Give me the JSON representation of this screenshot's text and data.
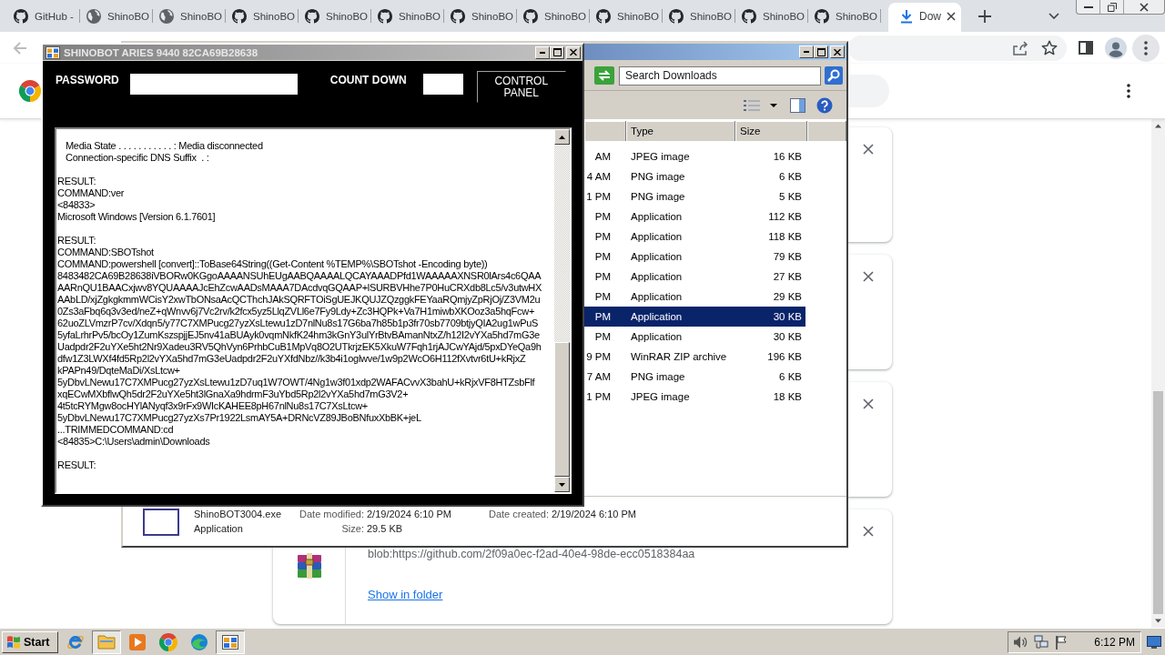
{
  "browser": {
    "tabs": [
      {
        "title": "GitHub -",
        "kind": "github",
        "selected": false
      },
      {
        "title": "ShinoBO",
        "kind": "globe",
        "selected": false
      },
      {
        "title": "ShinoBO",
        "kind": "globe",
        "selected": false
      },
      {
        "title": "ShinoBO",
        "kind": "github",
        "selected": false
      },
      {
        "title": "ShinoBO",
        "kind": "github",
        "selected": false
      },
      {
        "title": "ShinoBO",
        "kind": "github",
        "selected": false
      },
      {
        "title": "ShinoBO",
        "kind": "github",
        "selected": false
      },
      {
        "title": "ShinoBO",
        "kind": "github",
        "selected": false
      },
      {
        "title": "ShinoBO",
        "kind": "github",
        "selected": false
      },
      {
        "title": "ShinoBO",
        "kind": "github",
        "selected": false
      },
      {
        "title": "ShinoBO",
        "kind": "github",
        "selected": false
      },
      {
        "title": "ShinoBO",
        "kind": "github",
        "selected": false
      },
      {
        "title": "Dow",
        "kind": "download",
        "selected": true
      }
    ]
  },
  "shinobot": {
    "title": "SHINOBOT ARIES 9440 82CA69B28638",
    "password_label": "PASSWORD",
    "countdown_label": "COUNT DOWN",
    "control_button": "CONTROL PANEL",
    "output": [
      {
        "indent": true,
        "lines": [
          "Media State . . . . . . . . . . . : Media disconnected",
          "Connection-specific DNS Suffix  . :"
        ]
      },
      {
        "indent": false,
        "lines": [
          "RESULT:",
          "COMMAND:ver",
          "<84833>",
          "Microsoft Windows [Version 6.1.7601]"
        ]
      },
      {
        "indent": false,
        "lines": [
          "RESULT:",
          "COMMAND:SBOTshot",
          "COMMAND:powershell [convert]::ToBase64String((Get-Content %TEMP%\\SBOTshot -Encoding byte))",
          "8483482CA69B28638iVBORw0KGgoAAAANSUhEUgAABQAAAALQCAYAAADPfd1WAAAAAXNSR0lArs4c6QAA",
          "AARnQU1BAACxjwv8YQUAAAAJcEhZcwAADsMAAA7DAcdvqGQAAP+lSURBVHhe7P0HuCRXdb8Lc5/v3utwHX",
          "AAbLD/xjZgkgkmmWCisY2xwTbONsaAcQCThchJAkSQRFTOiSgUEJKQUJZQzggkFEYaaRQmjyZpRjOj/Z3VM2u",
          "0Zs3aFbq6q3v3ed/neZ+qWnvv6j7Vc2rv/k2fcx5yz5LlqZVLl6e7Fy9Ldy+Zc3HQPk+Va7H1miwbXKOoz3a5hqFcw+",
          "62uoZLVmzrP7cv/Xdqn5/y77C7XMPucg27yzXsLtewu1zD7nlNu8s17G6ba7h85b1p3fr70sb7709btjyQIA2ug1wPuS",
          "5yfaLrhrPv5/bcOy1ZumKszspjjEJ5nv41aBUAyk0vqmNkfK24hm3kGnY3ulYrBtvBAmanNtxZ/h12I2vYXa5hd7mG3e",
          "Uadpdr2F2uYXe5ht2Nr9Xadeu3RV5QhVyn6PrhbCuB1MpVq8O2UTkrjzEK5XkuW7Fqh1rjAJCwYAjd/5pxDYeQa9h",
          "dfw1Z3LWXf4fd5Rp2l2vYXa5hd7mG3eUadpdr2F2uYXfdNbz//k3b4i1oglwve/1w9p2WcO6H112fXvtvr6tU+kRjxZ",
          "kPAPn49/DqteMaDi/XsLtcw+",
          "5yDbvLNewu17C7XMPucg27yzXsLtewu1zD7uq1W7OWT/4Ng1w3f01xdp2WAFACvvX3bahU+kRjxVF8HTZsbFlf",
          "xqECwMXbflwQh5dr2F2uYXe5ht3lGnaXa9hdrmF3uYbd5Rp2l2vYXa5hd7mG3V2+",
          "4t5tcRYMgw8ocHYlANyqf3x9rFx9WIcKAHEE8pH67nlNu8s17C7XsLtcw+",
          "5yDbvLNewu17C7XMPucg27yzXs7Pr1922LsmAY5A+DRNcVZ89JBoBNfuxXbBK+jeL",
          "...TRIMMEDCOMMAND:cd",
          "<84835>C:\\Users\\admin\\Downloads"
        ]
      },
      {
        "indent": false,
        "lines": [
          "RESULT:"
        ]
      }
    ]
  },
  "explorer": {
    "search": {
      "placeholder": "Search Downloads"
    },
    "columns": [
      "Type",
      "Size"
    ],
    "rows": [
      {
        "column_1": "AM",
        "type": "JPEG image",
        "size": "16 KB",
        "selected": false
      },
      {
        "column_1": "4 AM",
        "type": "PNG image",
        "size": "6 KB",
        "selected": false
      },
      {
        "column_1": "1 PM",
        "type": "PNG image",
        "size": "5 KB",
        "selected": false
      },
      {
        "column_1": "PM",
        "type": "Application",
        "size": "112 KB",
        "selected": false
      },
      {
        "column_1": "PM",
        "type": "Application",
        "size": "118 KB",
        "selected": false
      },
      {
        "column_1": "PM",
        "type": "Application",
        "size": "79 KB",
        "selected": false
      },
      {
        "column_1": "PM",
        "type": "Application",
        "size": "27 KB",
        "selected": false
      },
      {
        "column_1": "PM",
        "type": "Application",
        "size": "29 KB",
        "selected": false
      },
      {
        "column_1": "PM",
        "type": "Application",
        "size": "30 KB",
        "selected": true
      },
      {
        "column_1": "PM",
        "type": "Application",
        "size": "30 KB",
        "selected": false
      },
      {
        "column_1": "9 PM",
        "type": "WinRAR ZIP archive",
        "size": "196 KB",
        "selected": false
      },
      {
        "column_1": "7 AM",
        "type": "PNG image",
        "size": "6 KB",
        "selected": false
      },
      {
        "column_1": "1 PM",
        "type": "JPEG image",
        "size": "18 KB",
        "selected": false
      }
    ],
    "details": {
      "lines": [
        {
          "text": "ShinoBOT3004.exe",
          "fields": [
            {
              "label": "Date modified:",
              "value": "2/19/2024 6:10 PM"
            },
            {
              "label": "Date created:",
              "value": "2/19/2024 6:10 PM"
            }
          ]
        },
        {
          "text": "Application",
          "fields": [
            {
              "label": "Size:",
              "value": "29.5 KB"
            }
          ]
        }
      ]
    }
  },
  "downloads": [
    {
      "kind": "covered"
    },
    {
      "kind": "covered"
    },
    {
      "kind": "covered"
    },
    {
      "kind": "archive",
      "url": "blob:https://github.com/2f09a0ec-f2ad-40e4-98de-ecc0518384aa",
      "link": "Show in folder"
    }
  ],
  "taskbar": {
    "start": "Start",
    "buttons": [
      {
        "kind": "ie",
        "selected": false
      },
      {
        "kind": "folder",
        "selected": true
      },
      {
        "kind": "media",
        "selected": false
      },
      {
        "kind": "chrome",
        "selected": false
      },
      {
        "kind": "edge",
        "selected": false
      },
      {
        "kind": "window",
        "selected": true
      }
    ],
    "clock": "6:12 PM"
  }
}
